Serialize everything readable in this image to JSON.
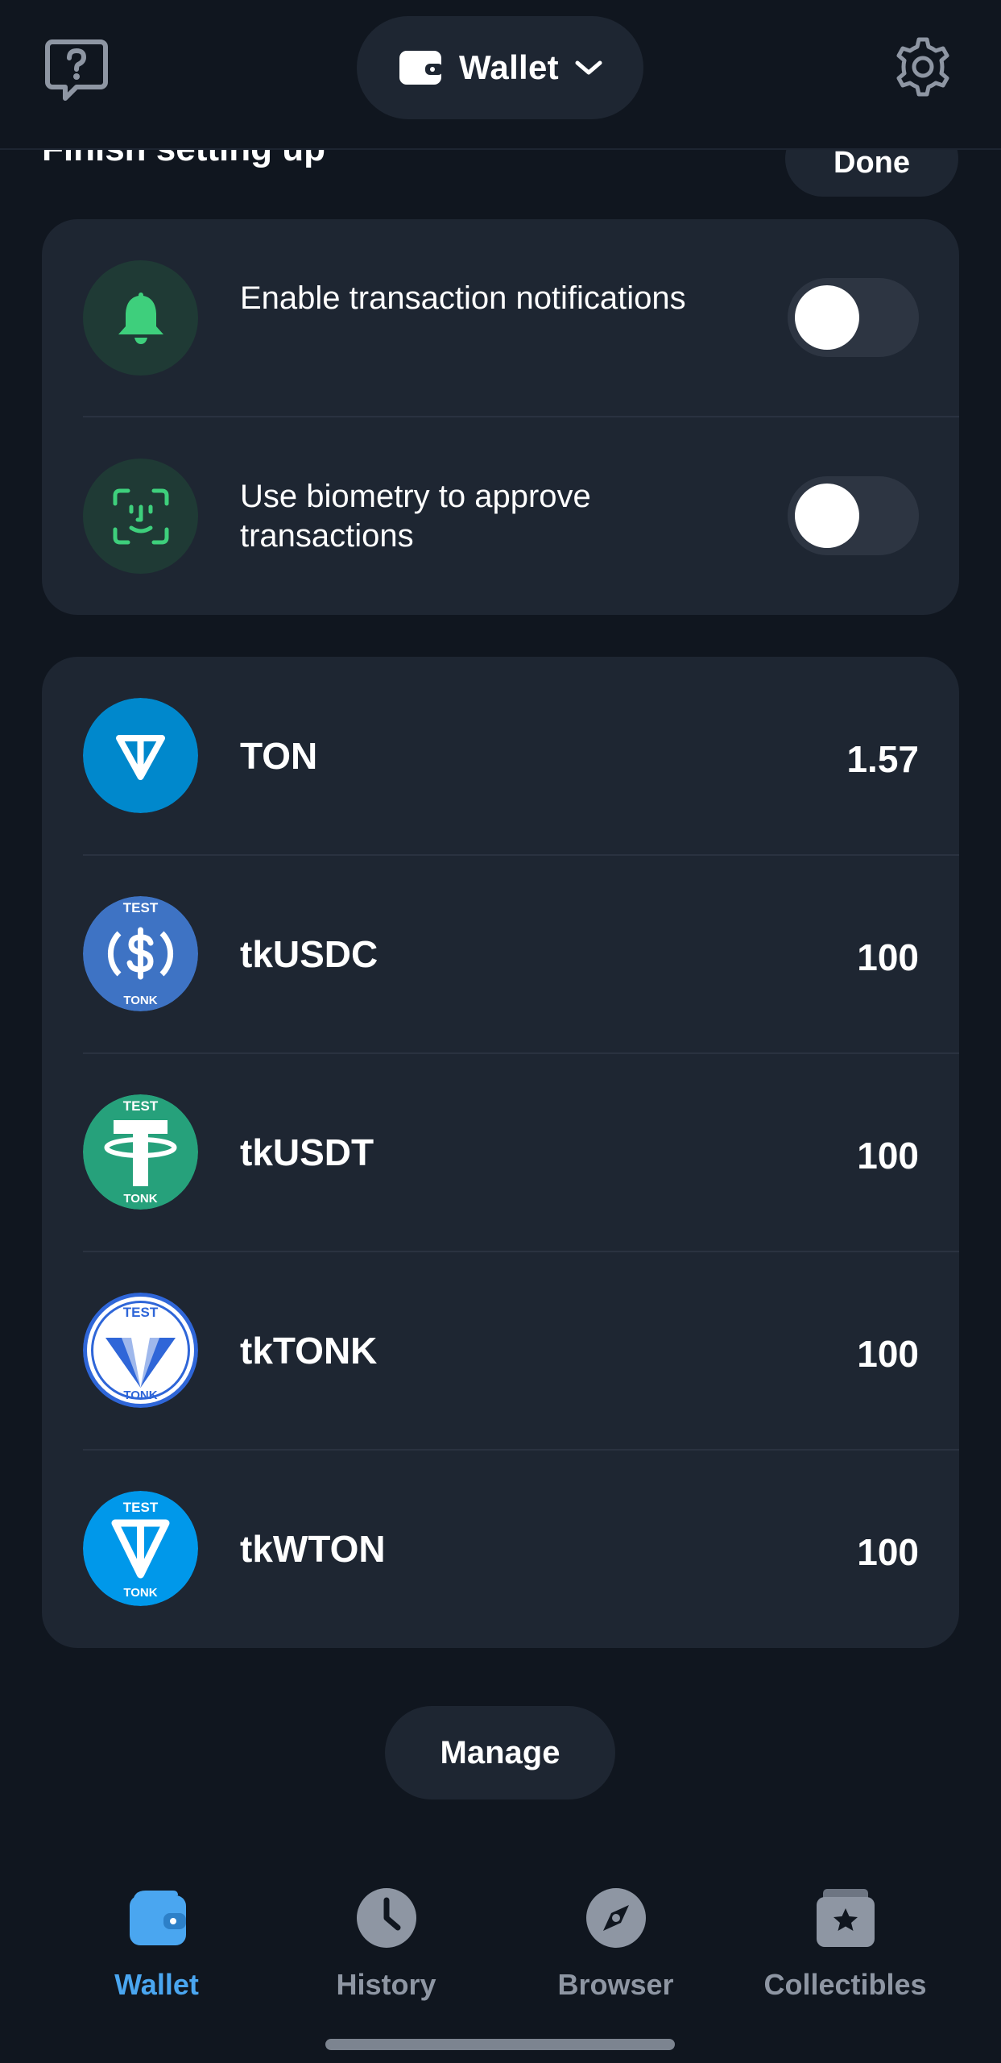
{
  "header": {
    "wallet_title": "Wallet",
    "help_icon": "question-bubble-icon",
    "settings_icon": "gear-icon"
  },
  "setup": {
    "title": "Finish setting up",
    "done_label": "Done",
    "items": [
      {
        "label": "Enable transaction notifications",
        "icon": "bell-icon",
        "toggle_on": false
      },
      {
        "label": "Use biometry to approve transactions",
        "icon": "face-id-icon",
        "toggle_on": false
      }
    ]
  },
  "tokens": [
    {
      "name": "TON",
      "amount": "1.57",
      "color": "#0088cc"
    },
    {
      "name": "tkUSDC",
      "amount": "100",
      "color": "#3e73c4",
      "badge_top": "TEST",
      "badge_bottom": "TONK"
    },
    {
      "name": "tkUSDT",
      "amount": "100",
      "color": "#26a17b",
      "badge_top": "TEST",
      "badge_bottom": "TONK"
    },
    {
      "name": "tkTONK",
      "amount": "100",
      "color": "#ffffff",
      "badge_top": "TEST",
      "badge_bottom": "TONK"
    },
    {
      "name": "tkWTON",
      "amount": "100",
      "color": "#0098ea",
      "badge_top": "TEST",
      "badge_bottom": "TONK"
    }
  ],
  "manage_label": "Manage",
  "nav": [
    {
      "label": "Wallet",
      "icon": "wallet-icon",
      "active": true
    },
    {
      "label": "History",
      "icon": "clock-icon",
      "active": false
    },
    {
      "label": "Browser",
      "icon": "compass-icon",
      "active": false
    },
    {
      "label": "Collectibles",
      "icon": "star-box-icon",
      "active": false
    }
  ],
  "colors": {
    "background": "#10161f",
    "card": "#1e2632",
    "accent": "#4aa6f0",
    "success": "#3ecf7c",
    "muted": "#8e96a3"
  }
}
